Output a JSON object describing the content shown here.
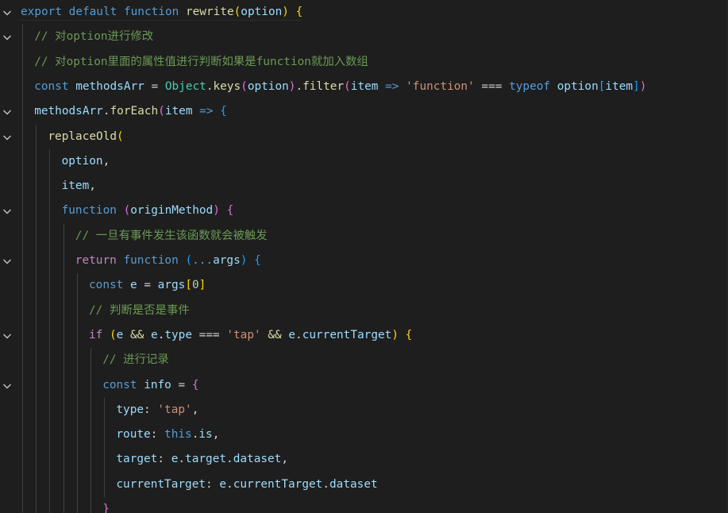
{
  "editor": {
    "lines": [
      {
        "indent": 0,
        "fold": true,
        "tokens": [
          {
            "t": "export",
            "c": "kw"
          },
          {
            "t": " "
          },
          {
            "t": "default",
            "c": "kw"
          },
          {
            "t": " "
          },
          {
            "t": "function",
            "c": "kw"
          },
          {
            "t": " "
          },
          {
            "t": "rewrite",
            "c": "fn"
          },
          {
            "t": "(",
            "c": "b1"
          },
          {
            "t": "option",
            "c": "param"
          },
          {
            "t": ")",
            "c": "b1"
          },
          {
            "t": " "
          },
          {
            "t": "{",
            "c": "b1"
          }
        ]
      },
      {
        "indent": 1,
        "fold": true,
        "tokens": [
          {
            "t": "// 对option进行修改",
            "c": "cmt"
          }
        ]
      },
      {
        "indent": 1,
        "fold": false,
        "tokens": [
          {
            "t": "// 对option里面的属性值进行判断如果是function就加入数组",
            "c": "cmt"
          }
        ]
      },
      {
        "indent": 1,
        "fold": false,
        "tokens": [
          {
            "t": "const",
            "c": "kw"
          },
          {
            "t": " "
          },
          {
            "t": "methodsArr",
            "c": "var"
          },
          {
            "t": " = "
          },
          {
            "t": "Object",
            "c": "cls"
          },
          {
            "t": "."
          },
          {
            "t": "keys",
            "c": "fn"
          },
          {
            "t": "(",
            "c": "b2"
          },
          {
            "t": "option",
            "c": "var"
          },
          {
            "t": ")",
            "c": "b2"
          },
          {
            "t": "."
          },
          {
            "t": "filter",
            "c": "fn"
          },
          {
            "t": "(",
            "c": "b2"
          },
          {
            "t": "item",
            "c": "param"
          },
          {
            "t": " "
          },
          {
            "t": "=>",
            "c": "kw"
          },
          {
            "t": " "
          },
          {
            "t": "'function'",
            "c": "str"
          },
          {
            "t": " === "
          },
          {
            "t": "typeof",
            "c": "kw"
          },
          {
            "t": " "
          },
          {
            "t": "option",
            "c": "var"
          },
          {
            "t": "[",
            "c": "b3"
          },
          {
            "t": "item",
            "c": "var"
          },
          {
            "t": "]",
            "c": "b3"
          },
          {
            "t": ")",
            "c": "b2"
          }
        ]
      },
      {
        "indent": 1,
        "fold": true,
        "tokens": [
          {
            "t": "methodsArr",
            "c": "var"
          },
          {
            "t": "."
          },
          {
            "t": "forEach",
            "c": "fn"
          },
          {
            "t": "(",
            "c": "b2"
          },
          {
            "t": "item",
            "c": "param"
          },
          {
            "t": " "
          },
          {
            "t": "=>",
            "c": "kw"
          },
          {
            "t": " "
          },
          {
            "t": "{",
            "c": "b3"
          }
        ]
      },
      {
        "indent": 2,
        "fold": true,
        "tokens": [
          {
            "t": "replaceOld",
            "c": "fn"
          },
          {
            "t": "(",
            "c": "b1"
          }
        ]
      },
      {
        "indent": 3,
        "fold": false,
        "tokens": [
          {
            "t": "option",
            "c": "var"
          },
          {
            "t": ","
          }
        ]
      },
      {
        "indent": 3,
        "fold": false,
        "tokens": [
          {
            "t": "item",
            "c": "var"
          },
          {
            "t": ","
          }
        ]
      },
      {
        "indent": 3,
        "fold": true,
        "tokens": [
          {
            "t": "function",
            "c": "kw"
          },
          {
            "t": " "
          },
          {
            "t": "(",
            "c": "b2"
          },
          {
            "t": "originMethod",
            "c": "param"
          },
          {
            "t": ")",
            "c": "b2"
          },
          {
            "t": " "
          },
          {
            "t": "{",
            "c": "b2"
          }
        ]
      },
      {
        "indent": 4,
        "fold": false,
        "tokens": [
          {
            "t": "// 一旦有事件发生该函数就会被触发",
            "c": "cmt"
          }
        ]
      },
      {
        "indent": 4,
        "fold": true,
        "tokens": [
          {
            "t": "return",
            "c": "ctrl"
          },
          {
            "t": " "
          },
          {
            "t": "function",
            "c": "kw"
          },
          {
            "t": " "
          },
          {
            "t": "(",
            "c": "b3"
          },
          {
            "t": "...",
            "c": "kw"
          },
          {
            "t": "args",
            "c": "param"
          },
          {
            "t": ")",
            "c": "b3"
          },
          {
            "t": " "
          },
          {
            "t": "{",
            "c": "b3"
          }
        ]
      },
      {
        "indent": 5,
        "fold": false,
        "tokens": [
          {
            "t": "const",
            "c": "kw"
          },
          {
            "t": " "
          },
          {
            "t": "e",
            "c": "var"
          },
          {
            "t": " = "
          },
          {
            "t": "args",
            "c": "var"
          },
          {
            "t": "[",
            "c": "b1"
          },
          {
            "t": "0",
            "c": "num"
          },
          {
            "t": "]",
            "c": "b1"
          }
        ]
      },
      {
        "indent": 5,
        "fold": false,
        "tokens": [
          {
            "t": "// 判断是否是事件",
            "c": "cmt"
          }
        ]
      },
      {
        "indent": 5,
        "fold": true,
        "tokens": [
          {
            "t": "if",
            "c": "ctrl"
          },
          {
            "t": " "
          },
          {
            "t": "(",
            "c": "b1"
          },
          {
            "t": "e",
            "c": "var"
          },
          {
            "t": " "
          },
          {
            "t": "&&",
            "c": "fn"
          },
          {
            "t": " "
          },
          {
            "t": "e",
            "c": "var"
          },
          {
            "t": "."
          },
          {
            "t": "type",
            "c": "var"
          },
          {
            "t": " === "
          },
          {
            "t": "'tap'",
            "c": "str"
          },
          {
            "t": " "
          },
          {
            "t": "&&",
            "c": "fn"
          },
          {
            "t": " "
          },
          {
            "t": "e",
            "c": "var"
          },
          {
            "t": "."
          },
          {
            "t": "currentTarget",
            "c": "var"
          },
          {
            "t": ")",
            "c": "b1"
          },
          {
            "t": " "
          },
          {
            "t": "{",
            "c": "b1"
          }
        ]
      },
      {
        "indent": 6,
        "fold": false,
        "tokens": [
          {
            "t": "// 进行记录",
            "c": "cmt"
          }
        ]
      },
      {
        "indent": 6,
        "fold": true,
        "tokens": [
          {
            "t": "const",
            "c": "kw"
          },
          {
            "t": " "
          },
          {
            "t": "info",
            "c": "var"
          },
          {
            "t": " = "
          },
          {
            "t": "{",
            "c": "b2"
          }
        ]
      },
      {
        "indent": 7,
        "fold": false,
        "tokens": [
          {
            "t": "type",
            "c": "var"
          },
          {
            "t": ": "
          },
          {
            "t": "'tap'",
            "c": "str"
          },
          {
            "t": ","
          }
        ]
      },
      {
        "indent": 7,
        "fold": false,
        "tokens": [
          {
            "t": "route",
            "c": "var"
          },
          {
            "t": ": "
          },
          {
            "t": "this",
            "c": "kw"
          },
          {
            "t": "."
          },
          {
            "t": "is",
            "c": "var"
          },
          {
            "t": ","
          }
        ]
      },
      {
        "indent": 7,
        "fold": false,
        "tokens": [
          {
            "t": "target",
            "c": "var"
          },
          {
            "t": ": "
          },
          {
            "t": "e",
            "c": "var"
          },
          {
            "t": "."
          },
          {
            "t": "target",
            "c": "var"
          },
          {
            "t": "."
          },
          {
            "t": "dataset",
            "c": "var"
          },
          {
            "t": ","
          }
        ]
      },
      {
        "indent": 7,
        "fold": false,
        "tokens": [
          {
            "t": "currentTarget",
            "c": "var"
          },
          {
            "t": ": "
          },
          {
            "t": "e",
            "c": "var"
          },
          {
            "t": "."
          },
          {
            "t": "currentTarget",
            "c": "var"
          },
          {
            "t": "."
          },
          {
            "t": "dataset",
            "c": "var"
          }
        ]
      },
      {
        "indent": 6,
        "fold": false,
        "tokens": [
          {
            "t": "}",
            "c": "b2"
          }
        ]
      }
    ]
  },
  "icons": {
    "fold": "chevron-down-icon"
  },
  "colors": {
    "background": "#1e1e1e",
    "keyword": "#569cd6",
    "control": "#c586c0",
    "function": "#dcdcaa",
    "string": "#ce9178",
    "number": "#b5cea8",
    "comment": "#6a9955",
    "variable": "#9cdcfe",
    "class": "#4ec9b0",
    "bracket1": "#ffd700",
    "bracket2": "#da70d6",
    "bracket3": "#179fff"
  }
}
